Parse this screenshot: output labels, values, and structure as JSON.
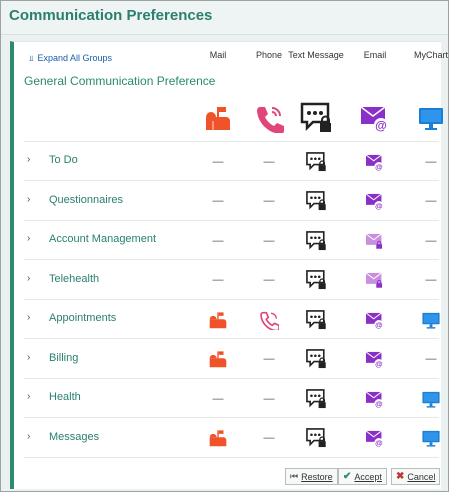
{
  "window": {
    "title": "Communication Preferences"
  },
  "toolbar": {
    "expand_all": "Expand All Groups"
  },
  "columns": [
    "Mail",
    "Phone",
    "Text Message",
    "Email",
    "MyChart"
  ],
  "general": {
    "label": "General Communication Preference"
  },
  "rows": [
    {
      "label": "To Do",
      "mail": "—",
      "phone": "—",
      "mychart": "—",
      "email_style": "normal"
    },
    {
      "label": "Questionnaires",
      "mail": "—",
      "phone": "—",
      "mychart": "—",
      "email_style": "normal"
    },
    {
      "label": "Account Management",
      "mail": "—",
      "phone": "—",
      "mychart": "—",
      "email_style": "locked"
    },
    {
      "label": "Telehealth",
      "mail": "—",
      "phone": "—",
      "mychart": "—",
      "email_style": "locked"
    },
    {
      "label": "Appointments",
      "mail": "mailbox-icon",
      "phone": "phone-icon",
      "mychart": "monitor-icon",
      "email_style": "normal"
    },
    {
      "label": "Billing",
      "mail": "mailbox-icon",
      "phone": "—",
      "mychart": "—",
      "email_style": "normal"
    },
    {
      "label": "Health",
      "mail": "—",
      "phone": "—",
      "mychart": "monitor-icon",
      "email_style": "normal"
    },
    {
      "label": "Messages",
      "mail": "mailbox-icon",
      "phone": "—",
      "mychart": "monitor-icon",
      "email_style": "normal"
    }
  ],
  "buttons": {
    "restore": "Restore",
    "accept": "Accept",
    "cancel": "Cancel"
  },
  "colors": {
    "accent": "#2e8a6c",
    "mail": "#f0522a",
    "phone": "#e0457b",
    "email": "#8b2fc9",
    "email_locked": "#c98ee0",
    "mychart": "#1b7fd6"
  }
}
